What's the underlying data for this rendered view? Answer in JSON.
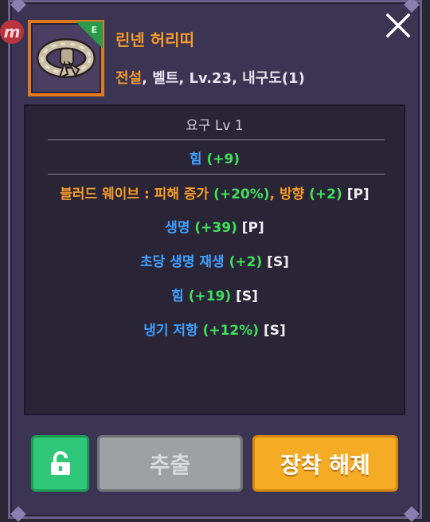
{
  "item": {
    "name": "린넨 허리띠",
    "grade_letter": "E",
    "rarity": "전설",
    "info_rest": ", 벨트, Lv.23, 내구도(1)"
  },
  "stats": {
    "requirement": "요구 Lv 1",
    "base": {
      "name": "힘",
      "value": "(+9)"
    },
    "set_effect": {
      "prefix": "블러드 웨이브 : 피해 증가",
      "v1": "(+20%)",
      "mid": ", 방향",
      "v2": "(+2)",
      "tag": "[P]"
    },
    "options": [
      {
        "name": "생명",
        "value": "(+39)",
        "tag": "[P]"
      },
      {
        "name": "초당 생명 재생",
        "value": "(+2)",
        "tag": "[S]"
      },
      {
        "name": "힘",
        "value": "(+19)",
        "tag": "[S]"
      },
      {
        "name": "냉기 저항",
        "value": "(+12%)",
        "tag": "[S]"
      }
    ]
  },
  "buttons": {
    "extract": "추출",
    "unequip": "장착 해제"
  },
  "watermark": "m",
  "colors": {
    "legendary": "#f39a2a",
    "stat_name": "#3fa0ff",
    "stat_value": "#3ee05a",
    "lock_button": "#2fc878",
    "unequip_button": "#f6ab25"
  }
}
